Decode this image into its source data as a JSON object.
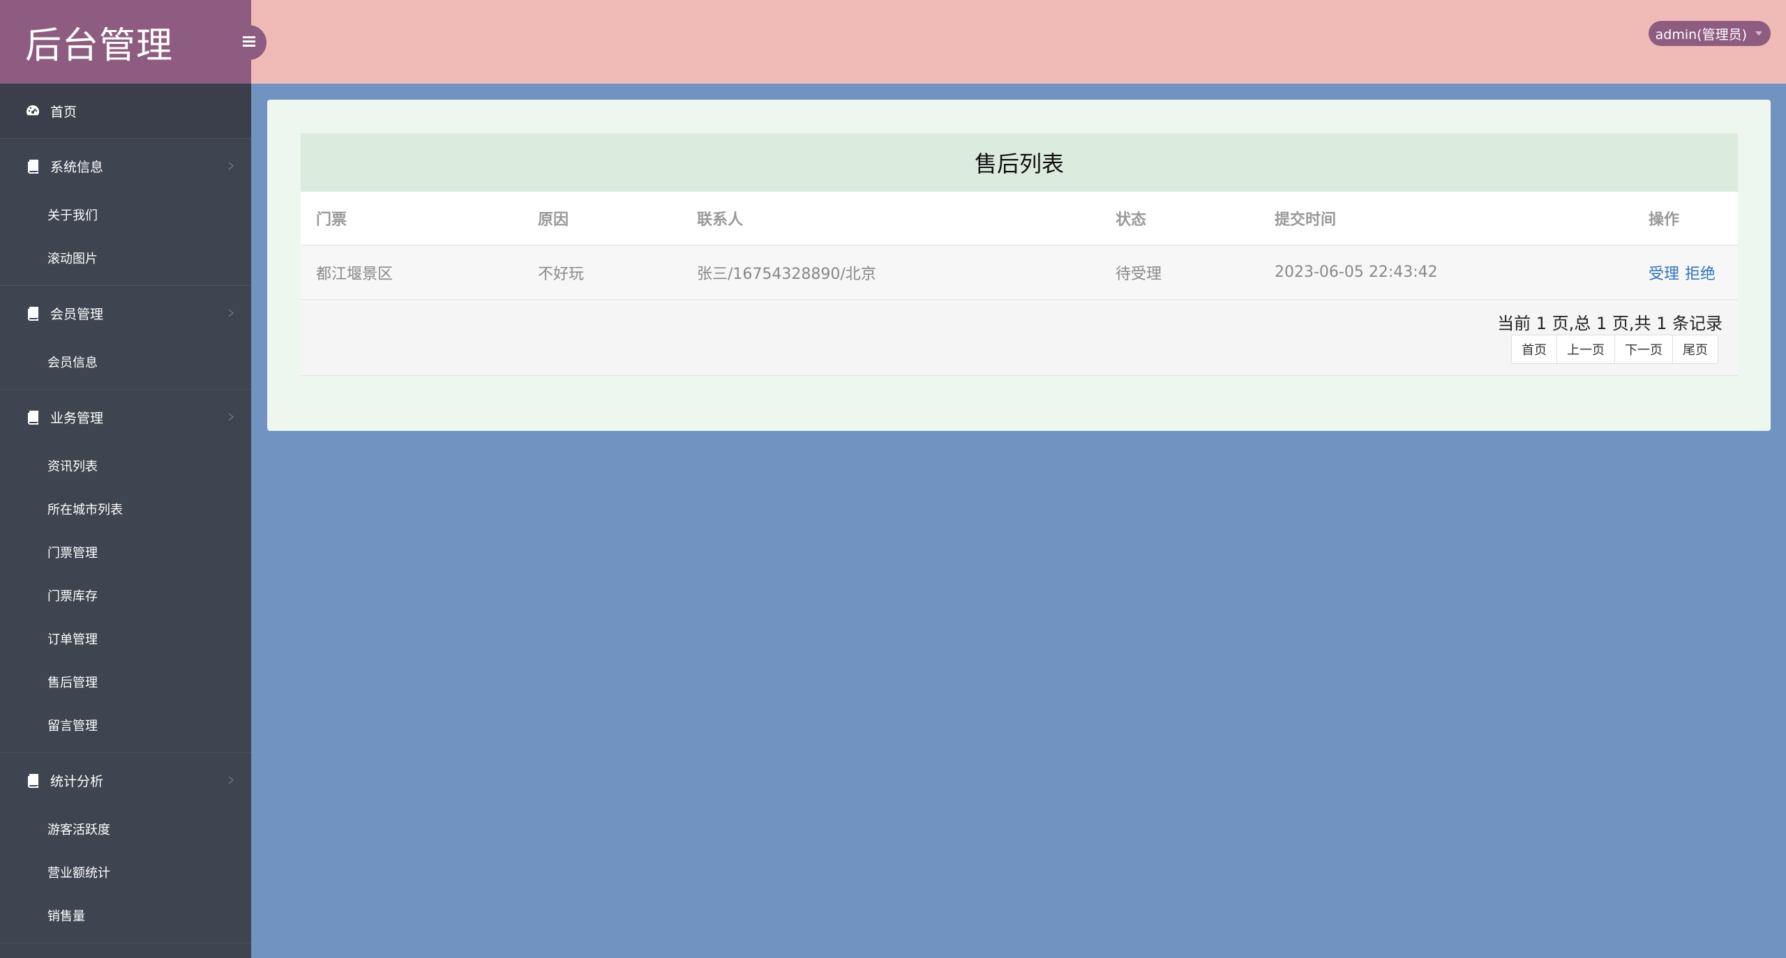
{
  "brand": {
    "title": "后台管理"
  },
  "header": {
    "user": "admin(管理员)"
  },
  "sidebar": {
    "home": {
      "label": "首页"
    },
    "groups": [
      {
        "label": "系统信息",
        "items": [
          "关于我们",
          "滚动图片"
        ]
      },
      {
        "label": "会员管理",
        "items": [
          "会员信息"
        ]
      },
      {
        "label": "业务管理",
        "items": [
          "资讯列表",
          "所在城市列表",
          "门票管理",
          "门票库存",
          "订单管理",
          "售后管理",
          "留言管理"
        ]
      },
      {
        "label": "统计分析",
        "items": [
          "游客活跃度",
          "营业额统计",
          "销售量"
        ]
      }
    ]
  },
  "table": {
    "title": "售后列表",
    "columns": [
      "门票",
      "原因",
      "联系人",
      "状态",
      "提交时间",
      "操作"
    ],
    "rows": [
      {
        "ticket": "都江堰景区",
        "reason": "不好玩",
        "contact": "张三/16754328890/北京",
        "status": "待受理",
        "time": "2023-06-05 22:43:42",
        "actions": [
          "受理",
          "拒绝"
        ]
      }
    ]
  },
  "pagination": {
    "info": "当前 1 页,总 1 页,共 1 条记录",
    "buttons": [
      "首页",
      "上一页",
      "下一页",
      "尾页"
    ]
  }
}
